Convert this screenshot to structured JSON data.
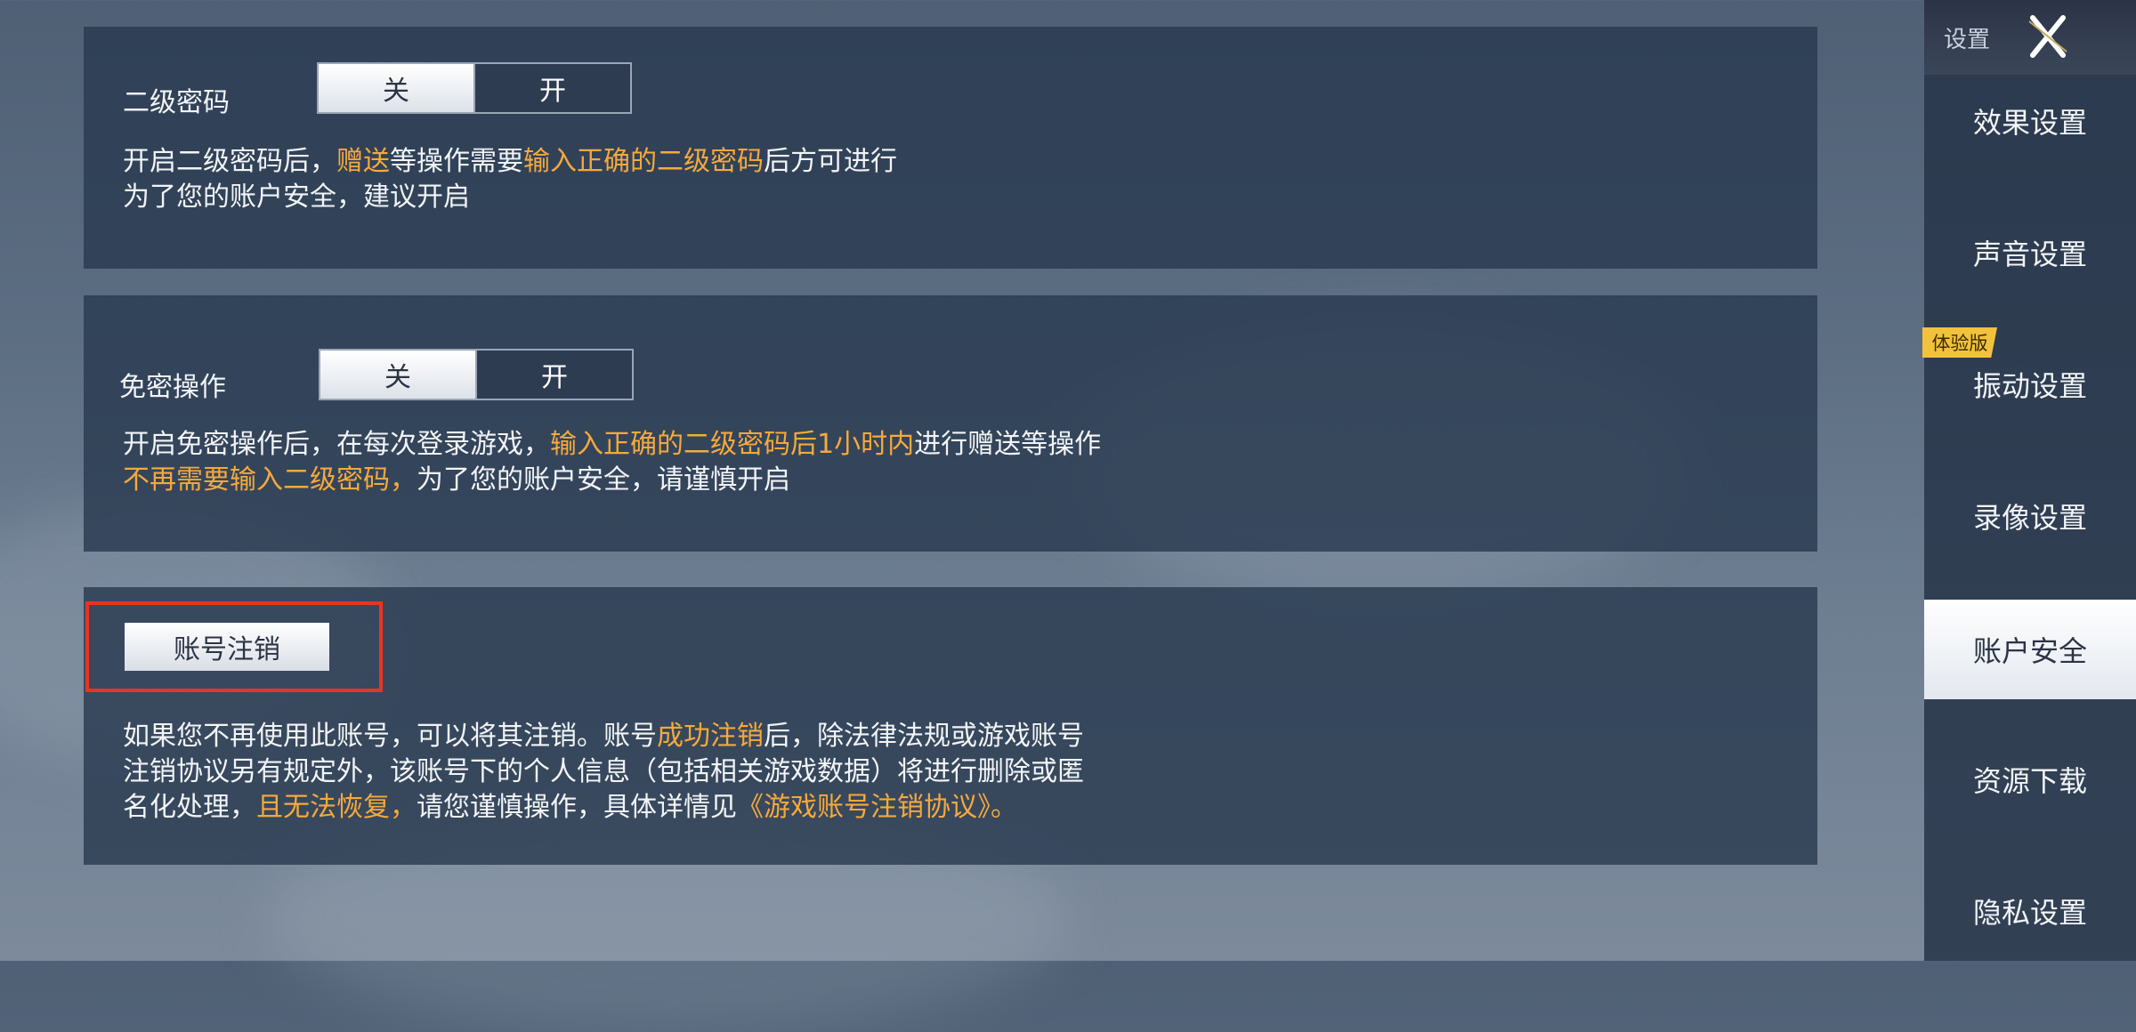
{
  "colors": {
    "highlight": "#f6a93b",
    "outline": "#ea3323",
    "panel_bg": "#2a3a50"
  },
  "section_password": {
    "label": "二级密码",
    "toggle_off": "关",
    "toggle_on": "开",
    "desc_line1_a": "开启二级密码后，",
    "desc_line1_b": "赠送",
    "desc_line1_c": "等操作需要",
    "desc_line1_d": "输入正确的二级密码",
    "desc_line1_e": "后方可进行",
    "desc_line2": "为了您的账户安全，建议开启"
  },
  "section_nopass": {
    "label": "免密操作",
    "toggle_off": "关",
    "toggle_on": "开",
    "desc_line1_a": "开启免密操作后，在每次登录游戏，",
    "desc_line1_b": "输入正确的二级密码后1小时内",
    "desc_line1_c": "进行赠送等操作",
    "desc_line2_a": "不再需要输入二级密码，",
    "desc_line2_b": "为了您的账户安全，请谨慎开启"
  },
  "section_deregister": {
    "button": "账号注销",
    "desc_line1_a": "如果您不再使用此账号，可以将其注销。账号",
    "desc_line1_b": "成功注销",
    "desc_line1_c": "后，除法律法规或游戏账号",
    "desc_line2": "注销协议另有规定外，该账号下的个人信息（包括相关游戏数据）将进行删除或匿",
    "desc_line3_a": "名化处理，",
    "desc_line3_b": "且无法恢复，",
    "desc_line3_c": "请您谨慎操作，具体详情见",
    "desc_line3_d": "《游戏账号注销协议》",
    "desc_line3_e": "。"
  },
  "sidebar": {
    "title": "设置",
    "close_icon": "close-icon",
    "badge": "体验版",
    "items": [
      {
        "label": "效果设置"
      },
      {
        "label": "声音设置"
      },
      {
        "label": "振动设置"
      },
      {
        "label": "录像设置"
      },
      {
        "label": "账户安全",
        "active": true
      },
      {
        "label": "资源下载"
      },
      {
        "label": "隐私设置"
      }
    ]
  }
}
